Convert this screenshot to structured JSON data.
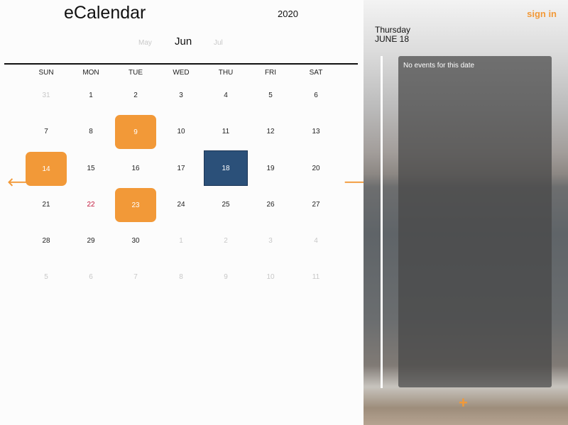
{
  "header": {
    "app_title": "eCalendar",
    "year": "2020",
    "prev_month": "May",
    "current_month": "Jun",
    "next_month": "Jul"
  },
  "weekdays": [
    "SUN",
    "MON",
    "TUE",
    "WED",
    "THU",
    "FRI",
    "SAT"
  ],
  "weeks": [
    [
      {
        "label": "31",
        "state": "muted"
      },
      {
        "label": "1",
        "state": ""
      },
      {
        "label": "2",
        "state": ""
      },
      {
        "label": "3",
        "state": ""
      },
      {
        "label": "4",
        "state": ""
      },
      {
        "label": "5",
        "state": ""
      },
      {
        "label": "6",
        "state": ""
      }
    ],
    [
      {
        "label": "7",
        "state": ""
      },
      {
        "label": "8",
        "state": ""
      },
      {
        "label": "9",
        "state": "event"
      },
      {
        "label": "10",
        "state": ""
      },
      {
        "label": "11",
        "state": ""
      },
      {
        "label": "12",
        "state": ""
      },
      {
        "label": "13",
        "state": ""
      }
    ],
    [
      {
        "label": "14",
        "state": "event"
      },
      {
        "label": "15",
        "state": ""
      },
      {
        "label": "16",
        "state": ""
      },
      {
        "label": "17",
        "state": ""
      },
      {
        "label": "18",
        "state": "selected"
      },
      {
        "label": "19",
        "state": ""
      },
      {
        "label": "20",
        "state": ""
      }
    ],
    [
      {
        "label": "21",
        "state": ""
      },
      {
        "label": "22",
        "state": "holiday"
      },
      {
        "label": "23",
        "state": "event"
      },
      {
        "label": "24",
        "state": ""
      },
      {
        "label": "25",
        "state": ""
      },
      {
        "label": "26",
        "state": ""
      },
      {
        "label": "27",
        "state": ""
      }
    ],
    [
      {
        "label": "28",
        "state": ""
      },
      {
        "label": "29",
        "state": ""
      },
      {
        "label": "30",
        "state": ""
      },
      {
        "label": "1",
        "state": "muted"
      },
      {
        "label": "2",
        "state": "muted"
      },
      {
        "label": "3",
        "state": "muted"
      },
      {
        "label": "4",
        "state": "muted"
      }
    ],
    [
      {
        "label": "5",
        "state": "muted"
      },
      {
        "label": "6",
        "state": "muted"
      },
      {
        "label": "7",
        "state": "muted"
      },
      {
        "label": "8",
        "state": "muted"
      },
      {
        "label": "9",
        "state": "muted"
      },
      {
        "label": "10",
        "state": "muted"
      },
      {
        "label": "11",
        "state": "muted"
      }
    ]
  ],
  "nav": {
    "prev_icon": "arrow-left-icon",
    "next_icon": "arrow-right-icon",
    "prev_glyph": "🡐",
    "next_glyph": "🡒"
  },
  "sidebar": {
    "sign_in_label": "sign in",
    "selected_weekday": "Thursday",
    "selected_date": "JUNE 18",
    "empty_message": "No events for this date",
    "add_glyph": "+"
  },
  "colors": {
    "accent": "#f29938",
    "selected": "#2b5079",
    "holiday": "#c2183c",
    "muted": "#c7c7c7"
  }
}
